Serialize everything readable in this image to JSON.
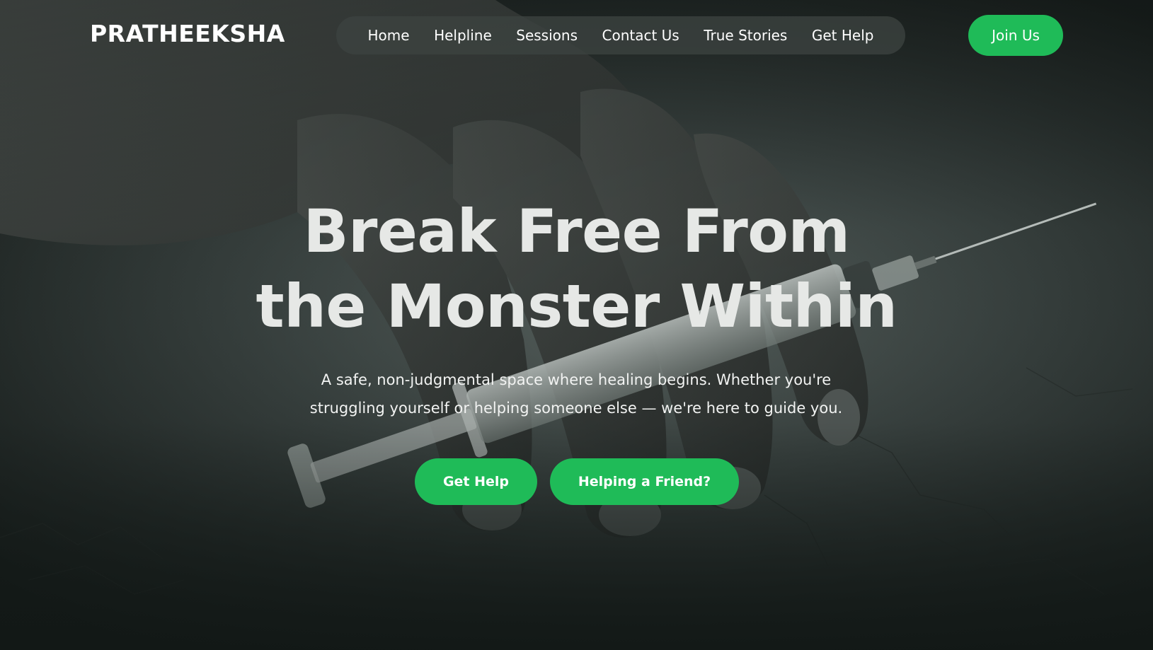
{
  "brand": {
    "name": "PRATHEEKSHA"
  },
  "nav": {
    "links": [
      {
        "label": "Home"
      },
      {
        "label": "Helpline"
      },
      {
        "label": "Sessions"
      },
      {
        "label": "Contact Us"
      },
      {
        "label": "True Stories"
      },
      {
        "label": "Get Help"
      }
    ],
    "join_label": "Join Us"
  },
  "hero": {
    "headline_line1": "Break Free From",
    "headline_line2": "the Monster Within",
    "subtitle_line1": "A safe, non-judgmental space where healing begins. Whether you're",
    "subtitle_line2": "struggling yourself or helping someone else — we're here to guide you.",
    "primary_cta": "Get Help",
    "secondary_cta": "Helping a Friend?",
    "background_image": "dark photo of an aged hand on cracked concrete beside a syringe"
  },
  "colors": {
    "accent": "#1fbb58",
    "nav_pill": "#3c4240",
    "headline_text": "#e6e8e6",
    "background_dark": "#141a18"
  }
}
